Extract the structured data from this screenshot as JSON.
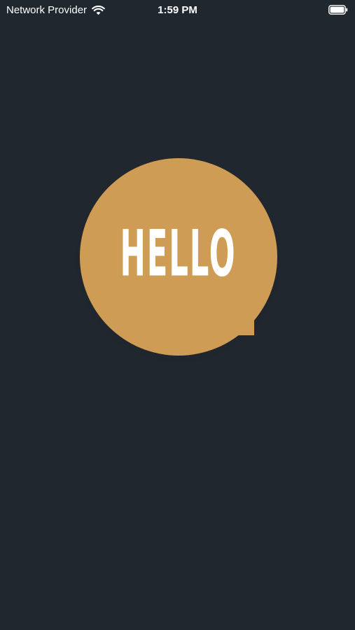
{
  "status_bar": {
    "carrier": "Network Provider",
    "time": "1:59 PM",
    "wifi_icon": "wifi-icon",
    "battery_icon": "battery-icon"
  },
  "logo": {
    "text": "HELLO",
    "shape": "speech-bubble",
    "fill_color": "#cf9c55",
    "text_color": "#ffffff"
  },
  "colors": {
    "background": "#21272e"
  }
}
